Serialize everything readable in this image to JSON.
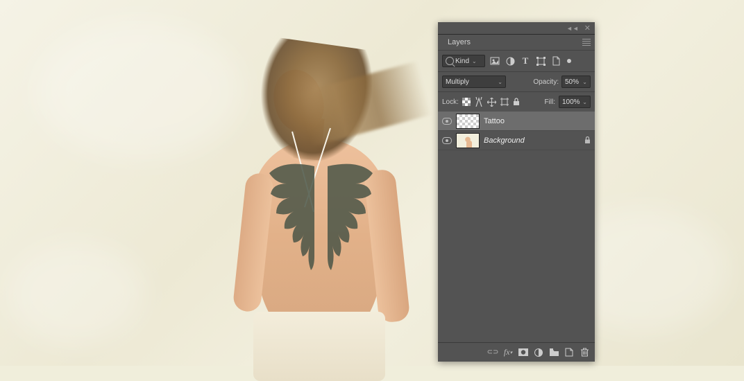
{
  "panel": {
    "title": "Layers",
    "filter": {
      "label": "Kind"
    },
    "blend_mode": "Multiply",
    "opacity": {
      "label": "Opacity:",
      "value": "50%"
    },
    "lock": {
      "label": "Lock:"
    },
    "fill": {
      "label": "Fill:",
      "value": "100%"
    },
    "layers": [
      {
        "name": "Tattoo",
        "visible": true,
        "selected": true,
        "locked": false,
        "thumb": "checker"
      },
      {
        "name": "Background",
        "visible": true,
        "selected": false,
        "locked": true,
        "thumb": "figure",
        "italic": true
      }
    ]
  }
}
